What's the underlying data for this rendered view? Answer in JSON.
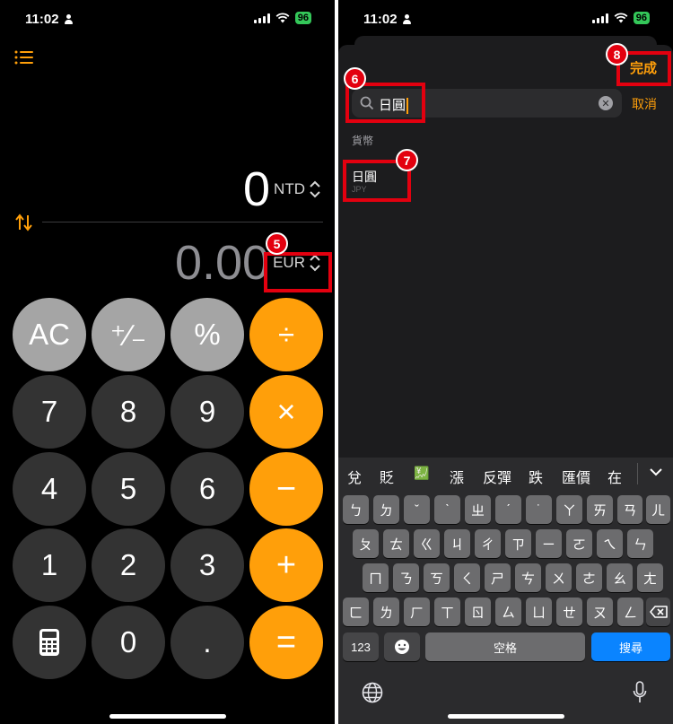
{
  "status": {
    "time": "11:02",
    "battery": "96"
  },
  "calculator": {
    "top_value": "0",
    "top_currency": "NTD",
    "bottom_value": "0.00",
    "bottom_currency": "EUR",
    "keys": [
      [
        "AC",
        "⁺∕₋",
        "%",
        "÷"
      ],
      [
        "7",
        "8",
        "9",
        "×"
      ],
      [
        "4",
        "5",
        "6",
        "−"
      ],
      [
        "1",
        "2",
        "3",
        "+"
      ],
      [
        "",
        "0",
        ".",
        "="
      ]
    ]
  },
  "annotations": {
    "n5": "5",
    "n6": "6",
    "n7": "7",
    "n8": "8"
  },
  "picker": {
    "done_label": "完成",
    "search_value": "日圓",
    "cancel_label": "取消",
    "section_title": "貨幣",
    "result_name": "日圓",
    "result_code": "JPY"
  },
  "keyboard": {
    "candidates": [
      "兌",
      "貶",
      "💹",
      "漲",
      "反彈",
      "跌",
      "匯價",
      "在"
    ],
    "row1": [
      "ㄅ",
      "ㄉ",
      "ˇ",
      "ˋ",
      "ㄓ",
      "ˊ",
      "˙",
      "ㄚ",
      "ㄞ",
      "ㄢ",
      "ㄦ"
    ],
    "row2": [
      "ㄆ",
      "ㄊ",
      "ㄍ",
      "ㄐ",
      "ㄔ",
      "ㄗ",
      "ㄧ",
      "ㄛ",
      "ㄟ",
      "ㄣ"
    ],
    "row3": [
      "ㄇ",
      "ㄋ",
      "ㄎ",
      "ㄑ",
      "ㄕ",
      "ㄘ",
      "ㄨ",
      "ㄜ",
      "ㄠ",
      "ㄤ"
    ],
    "row4": [
      "ㄈ",
      "ㄌ",
      "ㄏ",
      "ㄒ",
      "ㄖ",
      "ㄙ",
      "ㄩ",
      "ㄝ",
      "ㄡ",
      "ㄥ"
    ],
    "num_label": "123",
    "space_label": "空格",
    "search_label": "搜尋"
  },
  "colors": {
    "orange": "#ff9f0a",
    "annotation_red": "#e3000f",
    "search_blue": "#0a84ff"
  }
}
